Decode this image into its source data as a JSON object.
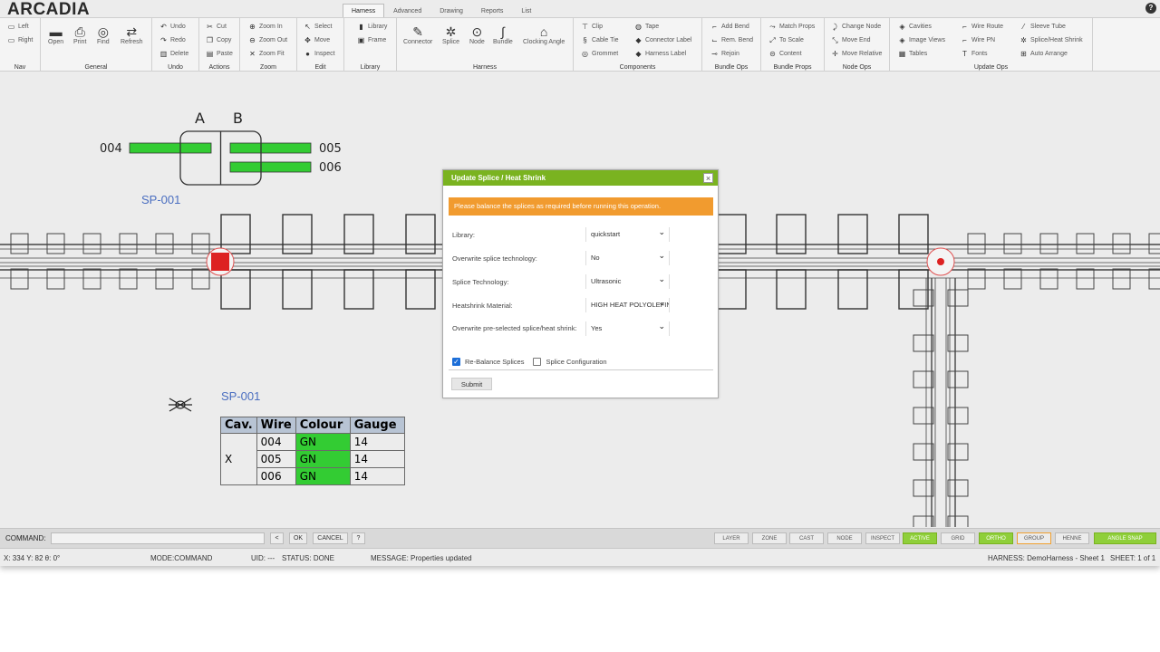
{
  "app": {
    "logo": "ARCADIA"
  },
  "tabs": [
    "Harness",
    "Advanced",
    "Drawing",
    "Reports",
    "List"
  ],
  "ribbon": {
    "nav": {
      "title": "Nav",
      "left": "Left",
      "right": "Right"
    },
    "general": {
      "title": "General",
      "open": "Open",
      "print": "Print",
      "find": "Find",
      "refresh": "Refresh"
    },
    "undo": {
      "title": "Undo",
      "undo": "Undo",
      "redo": "Redo",
      "delete": "Delete"
    },
    "actions": {
      "title": "Actions",
      "cut": "Cut",
      "copy": "Copy",
      "paste": "Paste"
    },
    "zoom": {
      "title": "Zoom",
      "zoom_in": "Zoom In",
      "zoom_out": "Zoom Out",
      "zoom_fit": "Zoom Fit"
    },
    "edit": {
      "title": "Edit",
      "select": "Select",
      "move": "Move",
      "inspect": "Inspect"
    },
    "library": {
      "title": "Library",
      "library": "Library",
      "frame": "Frame"
    },
    "harness": {
      "title": "Harness",
      "connector": "Connector",
      "splice": "Splice",
      "node": "Node",
      "bundle": "Bundle",
      "clocking_angle": "Clocking Angle"
    },
    "components": {
      "title": "Components",
      "clip": "Clip",
      "cable_tie": "Cable Tie",
      "grommet": "Grommet",
      "tape": "Tape",
      "connector_label": "Connector Label",
      "harness_label": "Harness Label"
    },
    "bundle_ops": {
      "title": "Bundle Ops",
      "add_bend": "Add Bend",
      "rem_bend": "Rem. Bend",
      "rejoin": "Rejoin"
    },
    "bundle_props": {
      "title": "Bundle Props",
      "match_props": "Match Props",
      "to_scale": "To Scale",
      "content": "Content"
    },
    "node_ops": {
      "title": "Node Ops",
      "change_node": "Change Node",
      "move_end": "Move End",
      "move_relative": "Move Relative"
    },
    "update_ops": {
      "title": "Update Ops",
      "cavities": "Cavities",
      "image_views": "Image Views",
      "tables": "Tables",
      "wire_route": "Wire Route",
      "wire_pn": "Wire PN",
      "fonts": "Fonts",
      "sleeve_tube": "Sleeve Tube",
      "splice_heat_shrink": "Splice/Heat Shrink",
      "auto_arrange": "Auto Arrange"
    }
  },
  "canvas": {
    "splice_label": "SP-001",
    "splice_label_2": "SP-001",
    "connector_cols": [
      "A",
      "B"
    ],
    "wires_left": [
      "004"
    ],
    "wires_right": [
      "005",
      "006"
    ],
    "table": {
      "headers": [
        "Cav.",
        "Wire",
        "Colour",
        "Gauge"
      ],
      "cav": "X",
      "rows": [
        {
          "wire": "004",
          "colour": "GN",
          "gauge": "14"
        },
        {
          "wire": "005",
          "colour": "GN",
          "gauge": "14"
        },
        {
          "wire": "006",
          "colour": "GN",
          "gauge": "14"
        }
      ]
    }
  },
  "dialog": {
    "title": "Update Splice / Heat Shrink",
    "warning": "Please balance the splices as required before running this operation.",
    "fields": [
      {
        "label": "Library:",
        "value": "quickstart"
      },
      {
        "label": "Overwrite splice technology:",
        "value": "No"
      },
      {
        "label": "Splice Technology:",
        "value": "Ultrasonic"
      },
      {
        "label": "Heatshrink Material:",
        "value": "HIGH HEAT POLYOLEFIN"
      },
      {
        "label": "Overwrite pre-selected splice/heat shrink:",
        "value": "Yes"
      }
    ],
    "rebalance_label": "Re-Balance Splices",
    "config_label": "Splice Configuration",
    "submit": "Submit"
  },
  "command": {
    "label": "COMMAND:",
    "value": "",
    "back": "<",
    "ok": "OK",
    "cancel": "CANCEL",
    "help": "?",
    "modes": [
      "LAYER",
      "ZONE",
      "CAST",
      "NODE",
      "INSPECT",
      "ACTIVE",
      "GRID",
      "ORTHO",
      "GROUP",
      "HENNE",
      "ANGLE SNAP"
    ]
  },
  "status": {
    "coords": "X: 334 Y: 82 θ: 0°",
    "mode": "MODE:COMMAND",
    "uid": "UID: ---",
    "state": "STATUS: DONE",
    "message": "MESSAGE: Properties updated",
    "harness": "HARNESS: DemoHarness - Sheet 1",
    "sheet": "SHEET: 1 of 1"
  },
  "colors": {
    "accent_green": "#7ab320",
    "warning": "#f19b2f",
    "wire_green": "#33cc33",
    "splice_red": "#e02828"
  }
}
